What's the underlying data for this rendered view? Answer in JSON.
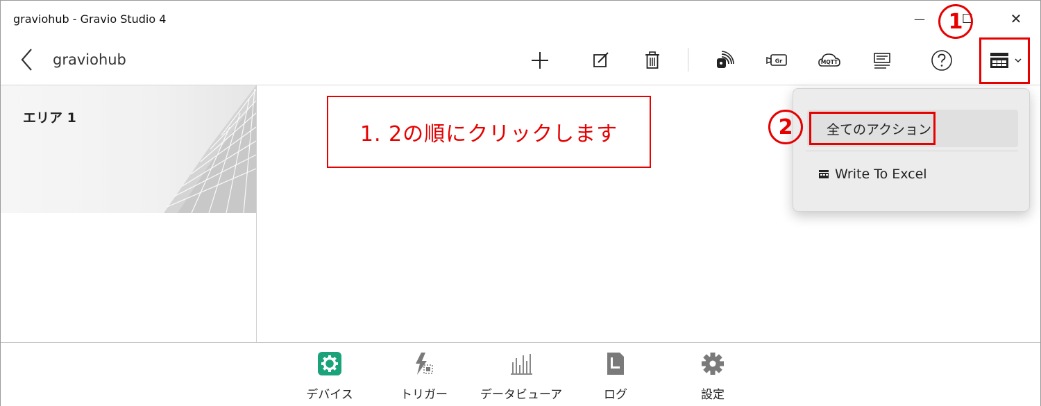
{
  "window": {
    "title": "graviohub - Gravio Studio 4",
    "minimize_glyph": "—",
    "maximize_glyph": "☐",
    "close_glyph": "✕"
  },
  "toolbar": {
    "hub_name": "graviohub",
    "icons": [
      "add-icon",
      "edit-icon",
      "delete-icon",
      "nfc-icon",
      "gravio-camera-icon",
      "mqtt-icon",
      "list-icon",
      "help-icon",
      "action-table-icon",
      "chevron-down-icon"
    ],
    "mqtt_label": "MQTT",
    "gr_label": "Gr"
  },
  "area_panel": {
    "area_name": "エリア 1"
  },
  "annotation": {
    "instruction": "1. 2の順にクリックします",
    "badge_1": "1",
    "badge_2": "2",
    "color": "#e60000"
  },
  "menu": {
    "all_actions": "全てのアクション",
    "write_to_excel": "Write To Excel"
  },
  "bottom_nav": {
    "items": [
      {
        "label": "デバイス",
        "icon": "device-gear-icon",
        "color": "#1aa37a"
      },
      {
        "label": "トリガー",
        "icon": "trigger-icon",
        "color": "#7a7a7a"
      },
      {
        "label": "データビューア",
        "icon": "data-viewer-icon",
        "color": "#7a7a7a"
      },
      {
        "label": "ログ",
        "icon": "log-icon",
        "color": "#7a7a7a"
      },
      {
        "label": "設定",
        "icon": "settings-gear-icon",
        "color": "#7a7a7a"
      }
    ]
  }
}
